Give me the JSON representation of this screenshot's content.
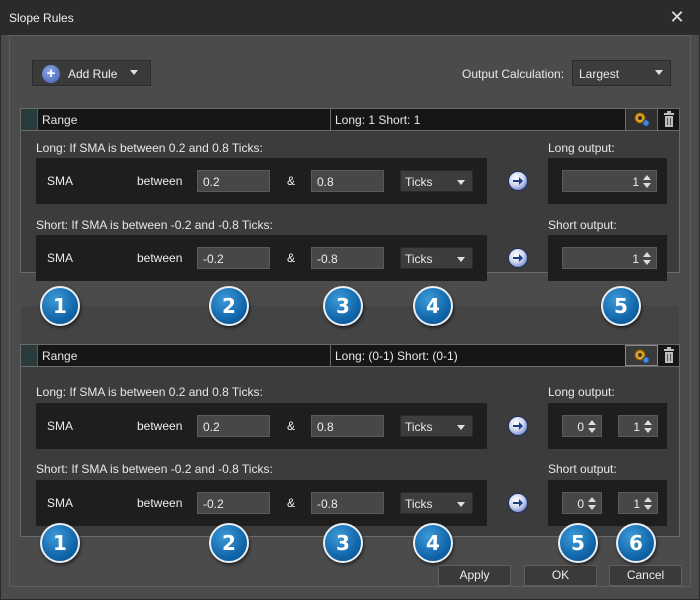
{
  "window": {
    "title": "Slope Rules"
  },
  "toolbar": {
    "add_rule_label": "Add Rule",
    "output_calc_label": "Output Calculation:",
    "output_calc_value": "Largest"
  },
  "rules": [
    {
      "range_label": "Range",
      "ls_label": "Long: 1 Short: 1",
      "long_title": "Long: If SMA is  between 0.2 and 0.8 Ticks:",
      "short_title": "Short: If SMA is  between -0.2 and -0.8 Ticks:",
      "long_output_label": "Long output:",
      "short_output_label": "Short output:",
      "long": {
        "indicator": "SMA",
        "op": "between",
        "v1": "0.2",
        "amp": "&",
        "v2": "0.8",
        "unit": "Ticks",
        "out": "1"
      },
      "short": {
        "indicator": "SMA",
        "op": "between",
        "v1": "-0.2",
        "amp": "&",
        "v2": "-0.8",
        "unit": "Ticks",
        "out": "1"
      }
    },
    {
      "range_label": "Range",
      "ls_label": "Long: (0-1) Short: (0-1)",
      "long_title": "Long: If SMA is  between 0.2 and 0.8 Ticks:",
      "short_title": "Short: If SMA is  between -0.2 and -0.8 Ticks:",
      "long_output_label": "Long output:",
      "short_output_label": "Short output:",
      "long": {
        "indicator": "SMA",
        "op": "between",
        "v1": "0.2",
        "amp": "&",
        "v2": "0.8",
        "unit": "Ticks",
        "out_lo": "0",
        "out_hi": "1"
      },
      "short": {
        "indicator": "SMA",
        "op": "between",
        "v1": "-0.2",
        "amp": "&",
        "v2": "-0.8",
        "unit": "Ticks",
        "out_lo": "0",
        "out_hi": "1"
      }
    }
  ],
  "callouts": {
    "n1": "1",
    "n2": "2",
    "n3": "3",
    "n4": "4",
    "n5": "5",
    "n6": "6"
  },
  "buttons": {
    "apply": "Apply",
    "ok": "OK",
    "cancel": "Cancel"
  },
  "icons": {
    "close": "close-icon",
    "add": "plus-circle-icon",
    "gear": "gear-icon",
    "trash": "trash-icon",
    "arrow": "arrow-right-icon"
  },
  "colors": {
    "badge": "#1167ab",
    "background": "#4b4b4b",
    "panel": "#1e1e1e"
  }
}
